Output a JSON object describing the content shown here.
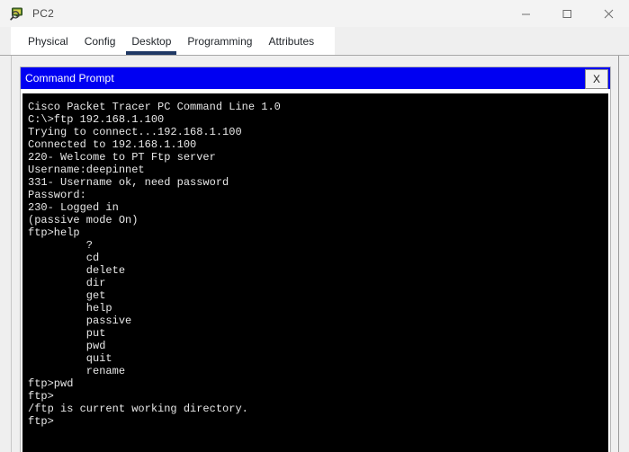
{
  "window": {
    "title": "PC2",
    "icon": "packet-tracer-pc-icon",
    "controls": {
      "minimize_label": "Minimize",
      "maximize_label": "Maximize",
      "close_label": "Close"
    }
  },
  "tabs": [
    {
      "label": "Physical",
      "active": false
    },
    {
      "label": "Config",
      "active": false
    },
    {
      "label": "Desktop",
      "active": true
    },
    {
      "label": "Programming",
      "active": false
    },
    {
      "label": "Attributes",
      "active": false
    }
  ],
  "command_prompt": {
    "title": "Command Prompt",
    "close_label": "X",
    "terminal_lines": [
      "Cisco Packet Tracer PC Command Line 1.0",
      "C:\\>ftp 192.168.1.100",
      "Trying to connect...192.168.1.100",
      "Connected to 192.168.1.100",
      "220- Welcome to PT Ftp server",
      "Username:deepinnet",
      "331- Username ok, need password",
      "Password:",
      "230- Logged in",
      "(passive mode On)",
      "ftp>help",
      "         ?",
      "         cd",
      "         delete",
      "         dir",
      "         get",
      "         help",
      "         passive",
      "         put",
      "         pwd",
      "         quit",
      "         rename",
      "ftp>pwd",
      "ftp>",
      "/ftp is current working directory.",
      "ftp>"
    ]
  },
  "colors": {
    "cmd_titlebar_blue": "#0000f2",
    "tab_active_underline": "#1f3864",
    "terminal_bg": "#000000",
    "terminal_fg": "#e8e8e8",
    "panel_bg": "#efefef"
  }
}
